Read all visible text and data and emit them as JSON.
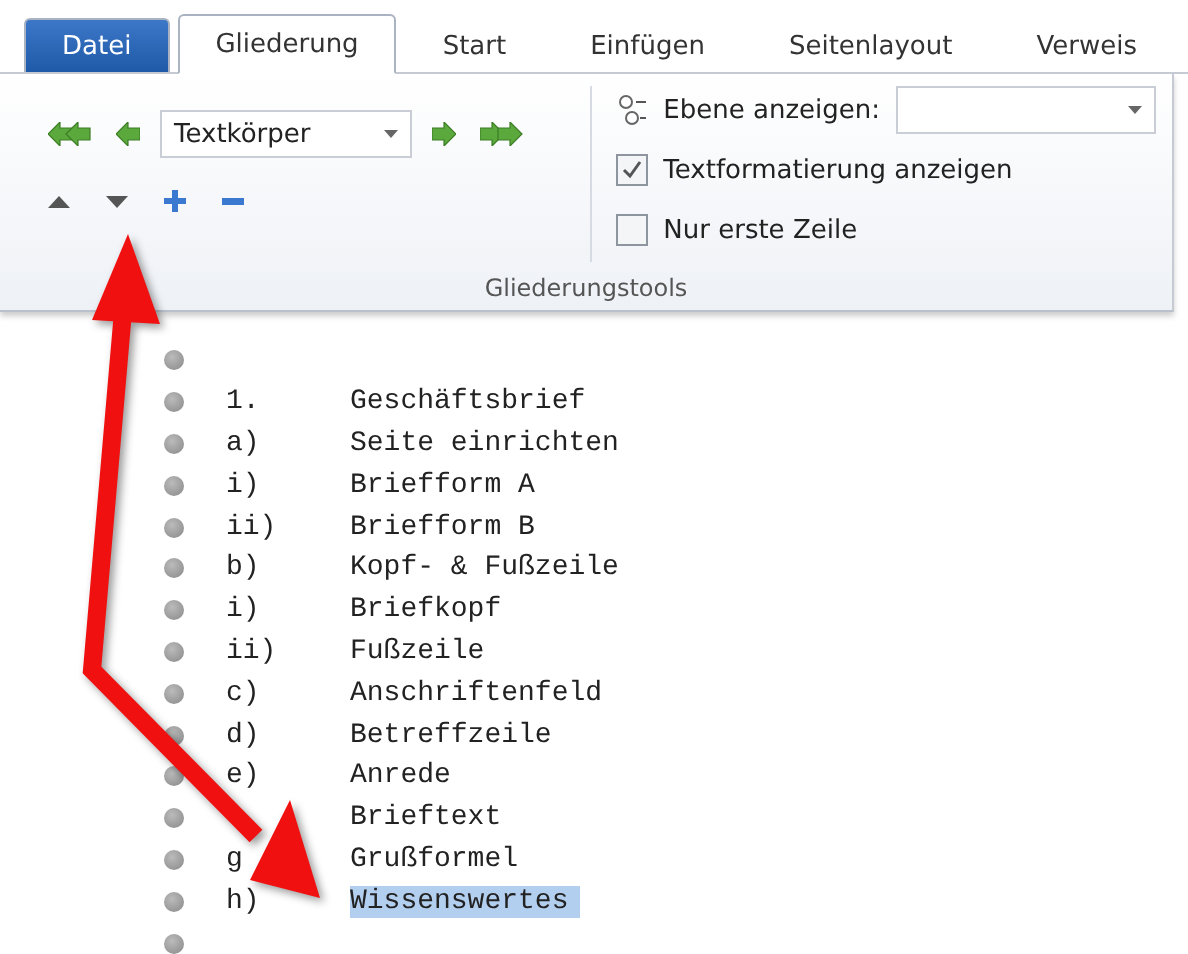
{
  "tabs": [
    {
      "label": "Datei",
      "kind": "file",
      "selected": false
    },
    {
      "label": "Gliederung",
      "kind": "tab",
      "selected": true
    },
    {
      "label": "Start",
      "kind": "tab",
      "selected": false
    },
    {
      "label": "Einfügen",
      "kind": "tab",
      "selected": false
    },
    {
      "label": "Seitenlayout",
      "kind": "tab",
      "selected": false
    },
    {
      "label": "Verweis",
      "kind": "tab",
      "selected": false
    }
  ],
  "ribbon": {
    "level_dropdown": {
      "value": "Textkörper"
    },
    "show_level": {
      "label": "Ebene anzeigen:"
    },
    "options": [
      {
        "label": "Textformatierung anzeigen",
        "checked": true
      },
      {
        "label": "Nur erste Zeile",
        "checked": false
      }
    ],
    "group_label": "Gliederungstools"
  },
  "outline": [
    {
      "number": "1.",
      "text": "Geschäftsbrief",
      "selected": false
    },
    {
      "number": "a)",
      "text": "Seite einrichten",
      "selected": false
    },
    {
      "number": "i)",
      "text": "Briefform A",
      "selected": false
    },
    {
      "number": "ii)",
      "text": "Briefform B",
      "selected": false
    },
    {
      "number": "b)",
      "text": "Kopf- & Fußzeile",
      "selected": false
    },
    {
      "number": "i)",
      "text": "Briefkopf",
      "selected": false
    },
    {
      "number": "ii)",
      "text": "Fußzeile",
      "selected": false
    },
    {
      "number": "c)",
      "text": "Anschriftenfeld",
      "selected": false
    },
    {
      "number": "d)",
      "text": "Betreffzeile",
      "selected": false
    },
    {
      "number": "e)",
      "text": "Anrede",
      "selected": false
    },
    {
      "text": "Brieftext",
      "selected": false
    },
    {
      "number": "g",
      "text": "Grußformel",
      "selected": false
    },
    {
      "number": "h)",
      "text": "Wissenswertes",
      "selected": true
    }
  ]
}
